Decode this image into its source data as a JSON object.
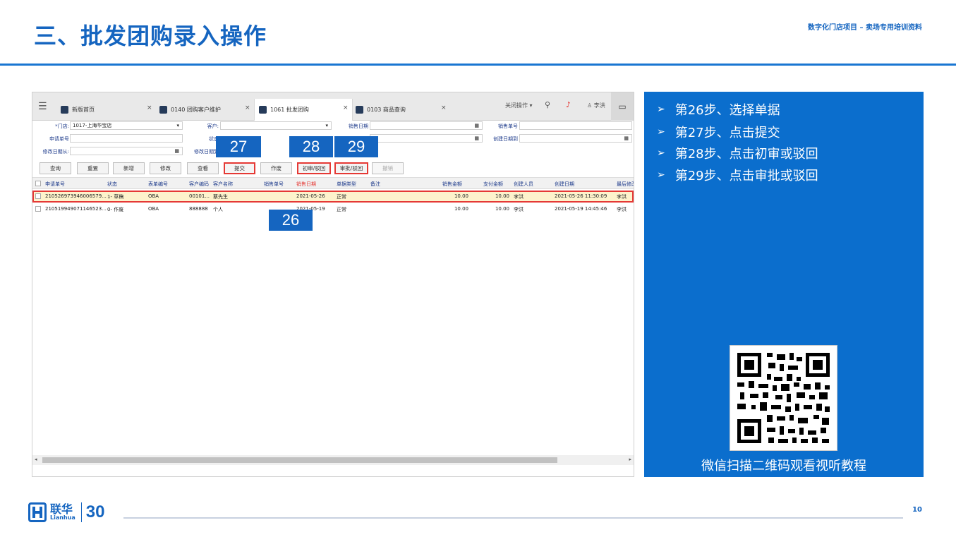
{
  "slide": {
    "title": "三、批发团购录入操作",
    "subtitle": "数字化门店项目 – 卖场专用培训资料",
    "page_number": "10",
    "logo_cn": "联华",
    "logo_en": "Lianhua",
    "logo_anniv": "30"
  },
  "app": {
    "tabs": [
      {
        "label": "新版首页"
      },
      {
        "label": "0140 团购客户维护"
      },
      {
        "label": "1061 批发团购"
      },
      {
        "label": "0103 商品查询"
      }
    ],
    "toolbar": {
      "close_ops": "关闭操作",
      "user": "李洪"
    },
    "filters": {
      "store_label": "*门店:",
      "store_value": "1017-上海华宝店",
      "customer_label": "客户:",
      "sale_date_label": "销售日期",
      "sale_no_label": "销售单号",
      "apply_no_label": "申请单号",
      "status_label": "状态",
      "create_date_label": "创建日期到",
      "modify_from_label": "修改日期从:",
      "modify_to_label": "修改日期到"
    },
    "buttons": [
      "查询",
      "重置",
      "新增",
      "修改",
      "查看",
      "提交",
      "作废",
      "初审/驳回",
      "审批/驳回",
      "撤销"
    ],
    "grid": {
      "columns": [
        "申请单号",
        "状态",
        "表单编号",
        "客户编码",
        "客户名称",
        "销售单号",
        "销售日期",
        "单据类型",
        "备注",
        "销售金额",
        "支付金额",
        "创建人员",
        "创建日期",
        "最后修改"
      ],
      "rows": [
        [
          "210526973946006579...",
          "1- 草稿",
          "OBA",
          "00101...",
          "蔡先生",
          "",
          "2021-05-26",
          "正常",
          "",
          "10.00",
          "10.00",
          "李洪",
          "2021-05-26 11:30:09",
          "李洪"
        ],
        [
          "210519949071146523...",
          "0- 作废",
          "OBA",
          "888888",
          "个人",
          "",
          "2021-05-19",
          "正常",
          "",
          "10.00",
          "10.00",
          "李洪",
          "2021-05-19 14:45:46",
          "李洪"
        ]
      ]
    },
    "badges": [
      "26",
      "27",
      "28",
      "29"
    ]
  },
  "panel": {
    "steps": [
      "第26步、选择单据",
      "第27步、点击提交",
      "第28步、点击初审或驳回",
      "第29步、点击审批或驳回"
    ],
    "qr_caption": "微信扫描二维码观看视听教程"
  },
  "colors": {
    "brand_blue": "#1565c0",
    "panel_blue": "#0b6ecd",
    "highlight_red": "#e53935"
  }
}
